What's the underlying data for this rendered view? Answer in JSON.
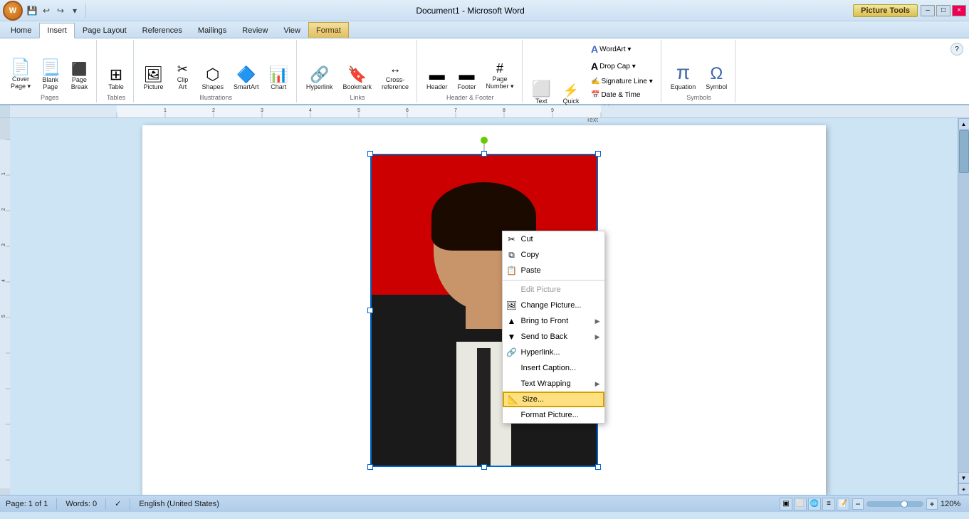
{
  "window": {
    "title": "Document1 - Microsoft Word",
    "picture_tools_label": "Picture Tools",
    "minimize_label": "–",
    "maximize_label": "□",
    "close_label": "×"
  },
  "ribbon": {
    "tabs": [
      {
        "id": "home",
        "label": "Home",
        "active": false
      },
      {
        "id": "insert",
        "label": "Insert",
        "active": true
      },
      {
        "id": "page_layout",
        "label": "Page Layout",
        "active": false
      },
      {
        "id": "references",
        "label": "References",
        "active": false
      },
      {
        "id": "mailings",
        "label": "Mailings",
        "active": false
      },
      {
        "id": "review",
        "label": "Review",
        "active": false
      },
      {
        "id": "view",
        "label": "View",
        "active": false
      },
      {
        "id": "format",
        "label": "Format",
        "active": false
      }
    ],
    "groups": {
      "pages": {
        "label": "Pages",
        "items": [
          {
            "id": "cover_page",
            "label": "Cover\nPage ▾",
            "icon": "📄"
          },
          {
            "id": "blank_page",
            "label": "Blank\nPage",
            "icon": "📃"
          },
          {
            "id": "page_break",
            "label": "Page\nBreak",
            "icon": "⬛"
          }
        ]
      },
      "tables": {
        "label": "Tables",
        "items": [
          {
            "id": "table",
            "label": "Table",
            "icon": "⊞"
          }
        ]
      },
      "illustrations": {
        "label": "Illustrations",
        "items": [
          {
            "id": "picture",
            "label": "Picture",
            "icon": "🖼"
          },
          {
            "id": "clip_art",
            "label": "Clip\nArt",
            "icon": "✂"
          },
          {
            "id": "shapes",
            "label": "Shapes",
            "icon": "○"
          },
          {
            "id": "smartart",
            "label": "SmartArt",
            "icon": "🔷"
          },
          {
            "id": "chart",
            "label": "Chart",
            "icon": "📊"
          }
        ]
      },
      "links": {
        "label": "Links",
        "items": [
          {
            "id": "hyperlink",
            "label": "Hyperlink",
            "icon": "🔗"
          },
          {
            "id": "bookmark",
            "label": "Bookmark",
            "icon": "🔖"
          },
          {
            "id": "cross_ref",
            "label": "Cross-reference",
            "icon": "↔"
          }
        ]
      },
      "header_footer": {
        "label": "Header & Footer",
        "items": [
          {
            "id": "header",
            "label": "Header",
            "icon": "▬"
          },
          {
            "id": "footer",
            "label": "Footer",
            "icon": "▬"
          },
          {
            "id": "page_number",
            "label": "Page\nNumber ▾",
            "icon": "#"
          }
        ]
      },
      "text": {
        "label": "Text",
        "items": [
          {
            "id": "text_box",
            "label": "Text\nBox ▾",
            "icon": "⬜"
          },
          {
            "id": "quick_parts",
            "label": "Quick\nParts ▾",
            "icon": "⚡"
          },
          {
            "id": "wordart",
            "label": "WordArt",
            "icon": "A"
          },
          {
            "id": "drop_cap",
            "label": "Drop\nCap ▾",
            "icon": "A"
          }
        ]
      },
      "symbols": {
        "label": "Symbols",
        "items": [
          {
            "id": "equation",
            "label": "Equation",
            "icon": "π"
          },
          {
            "id": "symbol",
            "label": "Symbol",
            "icon": "Ω"
          }
        ]
      }
    }
  },
  "context_menu": {
    "items": [
      {
        "id": "cut",
        "label": "Cut",
        "icon": "✂",
        "has_icon": true,
        "separator_after": false
      },
      {
        "id": "copy",
        "label": "Copy",
        "icon": "⧉",
        "has_icon": true,
        "separator_after": false
      },
      {
        "id": "paste",
        "label": "Paste",
        "icon": "📋",
        "has_icon": true,
        "separator_after": true
      },
      {
        "id": "edit_picture",
        "label": "Edit Picture",
        "has_icon": false,
        "disabled": true,
        "separator_after": false
      },
      {
        "id": "change_picture",
        "label": "Change Picture...",
        "icon": "🖼",
        "has_icon": true,
        "separator_after": false
      },
      {
        "id": "bring_to_front",
        "label": "Bring to Front",
        "icon": "▲",
        "has_icon": true,
        "has_arrow": true,
        "separator_after": false
      },
      {
        "id": "send_to_back",
        "label": "Send to Back",
        "icon": "▼",
        "has_icon": true,
        "has_arrow": true,
        "separator_after": false
      },
      {
        "id": "hyperlink",
        "label": "Hyperlink...",
        "icon": "🔗",
        "has_icon": true,
        "separator_after": false
      },
      {
        "id": "insert_caption",
        "label": "Insert Caption...",
        "has_icon": false,
        "separator_after": false
      },
      {
        "id": "text_wrapping",
        "label": "Text Wrapping",
        "has_icon": false,
        "has_arrow": true,
        "separator_after": false
      },
      {
        "id": "size",
        "label": "Size...",
        "icon": "📐",
        "has_icon": true,
        "highlighted": true,
        "separator_after": false
      },
      {
        "id": "format_picture",
        "label": "Format Picture...",
        "has_icon": false,
        "separator_after": false
      }
    ]
  },
  "status_bar": {
    "page": "Page: 1 of 1",
    "words": "Words: 0",
    "language": "English (United States)",
    "zoom": "120%"
  }
}
